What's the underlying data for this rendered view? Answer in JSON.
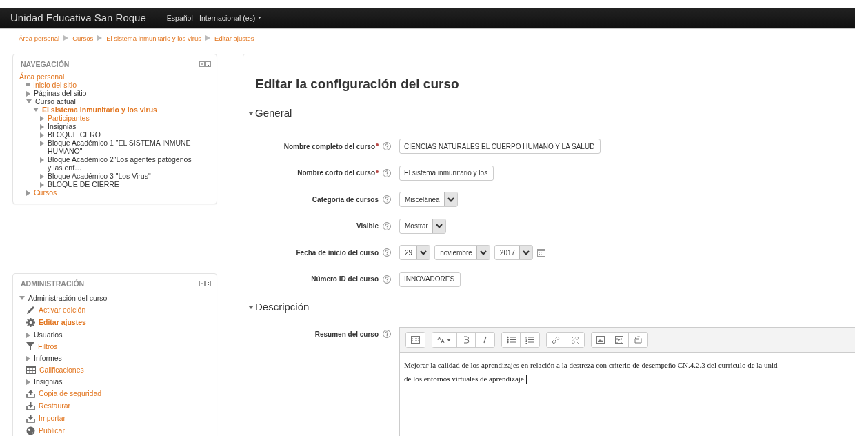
{
  "navbar": {
    "site_name": "Unidad Educativa San Roque",
    "language": "Español - Internacional (es)"
  },
  "breadcrumb": [
    "Área personal",
    "Cursos",
    "El sistema inmunitario y los virus",
    "Editar ajustes"
  ],
  "blocks": [
    {
      "title": "NAVEGACIÓN",
      "items": [
        {
          "label": "Área personal",
          "link": true,
          "active": false,
          "kind": "plain",
          "children": [
            {
              "label": "Inicio del sitio",
              "link": true,
              "active": false,
              "kind": "dot"
            },
            {
              "label": "Páginas del sitio",
              "link": false,
              "active": false,
              "kind": "collapsed"
            },
            {
              "label": "Curso actual",
              "link": false,
              "active": false,
              "kind": "expanded",
              "children": [
                {
                  "label": "El sistema inmunitario y los virus",
                  "link": true,
                  "active": true,
                  "kind": "expanded",
                  "children": [
                    {
                      "label": "Participantes",
                      "link": true,
                      "active": false,
                      "kind": "collapsed"
                    },
                    {
                      "label": "Insignias",
                      "link": false,
                      "active": false,
                      "kind": "collapsed"
                    },
                    {
                      "label": "BLOQUE CERO",
                      "link": false,
                      "active": false,
                      "kind": "collapsed"
                    },
                    {
                      "label": "Bloque Académico 1 \"EL SISTEMA INMUNE HUMANO\"",
                      "link": false,
                      "active": false,
                      "kind": "collapsed"
                    },
                    {
                      "label": "Bloque Académico 2\"Los agentes patógenos y las enf…",
                      "link": false,
                      "active": false,
                      "kind": "collapsed"
                    },
                    {
                      "label": "Bloque Académico 3 \"Los Virus\"",
                      "link": false,
                      "active": false,
                      "kind": "collapsed"
                    },
                    {
                      "label": "BLOQUE DE CIERRE",
                      "link": false,
                      "active": false,
                      "kind": "collapsed"
                    }
                  ]
                }
              ]
            },
            {
              "label": "Cursos",
              "link": true,
              "active": false,
              "kind": "collapsed"
            }
          ]
        }
      ]
    },
    {
      "title": "ADMINISTRACIÓN",
      "items": [
        {
          "label": "Administración del curso",
          "link": false,
          "active": false,
          "kind": "expanded",
          "children": [
            {
              "label": "Activar edición",
              "link": true,
              "active": false,
              "kind": "pencil"
            },
            {
              "label": "Editar ajustes",
              "link": true,
              "active": true,
              "kind": "gear"
            },
            {
              "label": "Usuarios",
              "link": false,
              "active": false,
              "kind": "collapsed"
            },
            {
              "label": "Filtros",
              "link": true,
              "active": false,
              "kind": "funnel"
            },
            {
              "label": "Informes",
              "link": false,
              "active": false,
              "kind": "collapsed"
            },
            {
              "label": "Calificaciones",
              "link": true,
              "active": false,
              "kind": "table"
            },
            {
              "label": "Insignias",
              "link": false,
              "active": false,
              "kind": "collapsed"
            },
            {
              "label": "Copia de seguridad",
              "link": true,
              "active": false,
              "kind": "upload"
            },
            {
              "label": "Restaurar",
              "link": true,
              "active": false,
              "kind": "download"
            },
            {
              "label": "Importar",
              "link": true,
              "active": false,
              "kind": "download"
            },
            {
              "label": "Publicar",
              "link": true,
              "active": false,
              "kind": "globe"
            }
          ]
        }
      ]
    }
  ],
  "page_title": "Editar la configuración del curso",
  "sections": [
    {
      "title": "General",
      "expanded": true,
      "fields": [
        {
          "kind": "text",
          "label": "Nombre completo del curso",
          "required": true,
          "value": "CIENCIAS NATURALES EL CUERPO HUMANO Y LA SALUD"
        },
        {
          "kind": "text",
          "label": "Nombre corto del curso",
          "required": true,
          "value": "El sistema inmunitario y los"
        },
        {
          "kind": "select",
          "label": "Categoría de cursos",
          "required": false,
          "values": [
            "Miscelánea"
          ]
        },
        {
          "kind": "select",
          "label": "Visible",
          "required": false,
          "values": [
            "Mostrar"
          ]
        },
        {
          "kind": "date",
          "label": "Fecha de inicio del curso",
          "required": false,
          "values": [
            "29",
            "noviembre",
            "2017"
          ]
        },
        {
          "kind": "text",
          "label": "Número ID del curso",
          "required": false,
          "value": "INNOVADORES"
        }
      ]
    },
    {
      "title": "Descripción",
      "expanded": true,
      "fields": [
        {
          "kind": "editor",
          "label": "Resumen del curso",
          "required": false,
          "lines": [
            "Mejorar la calidad de los aprendizajes en relación a la destreza con criterio de desempeño CN.4.2.3 del curriculo de la unid",
            "de los entornos virtuales de aprendizaje."
          ]
        }
      ]
    }
  ]
}
